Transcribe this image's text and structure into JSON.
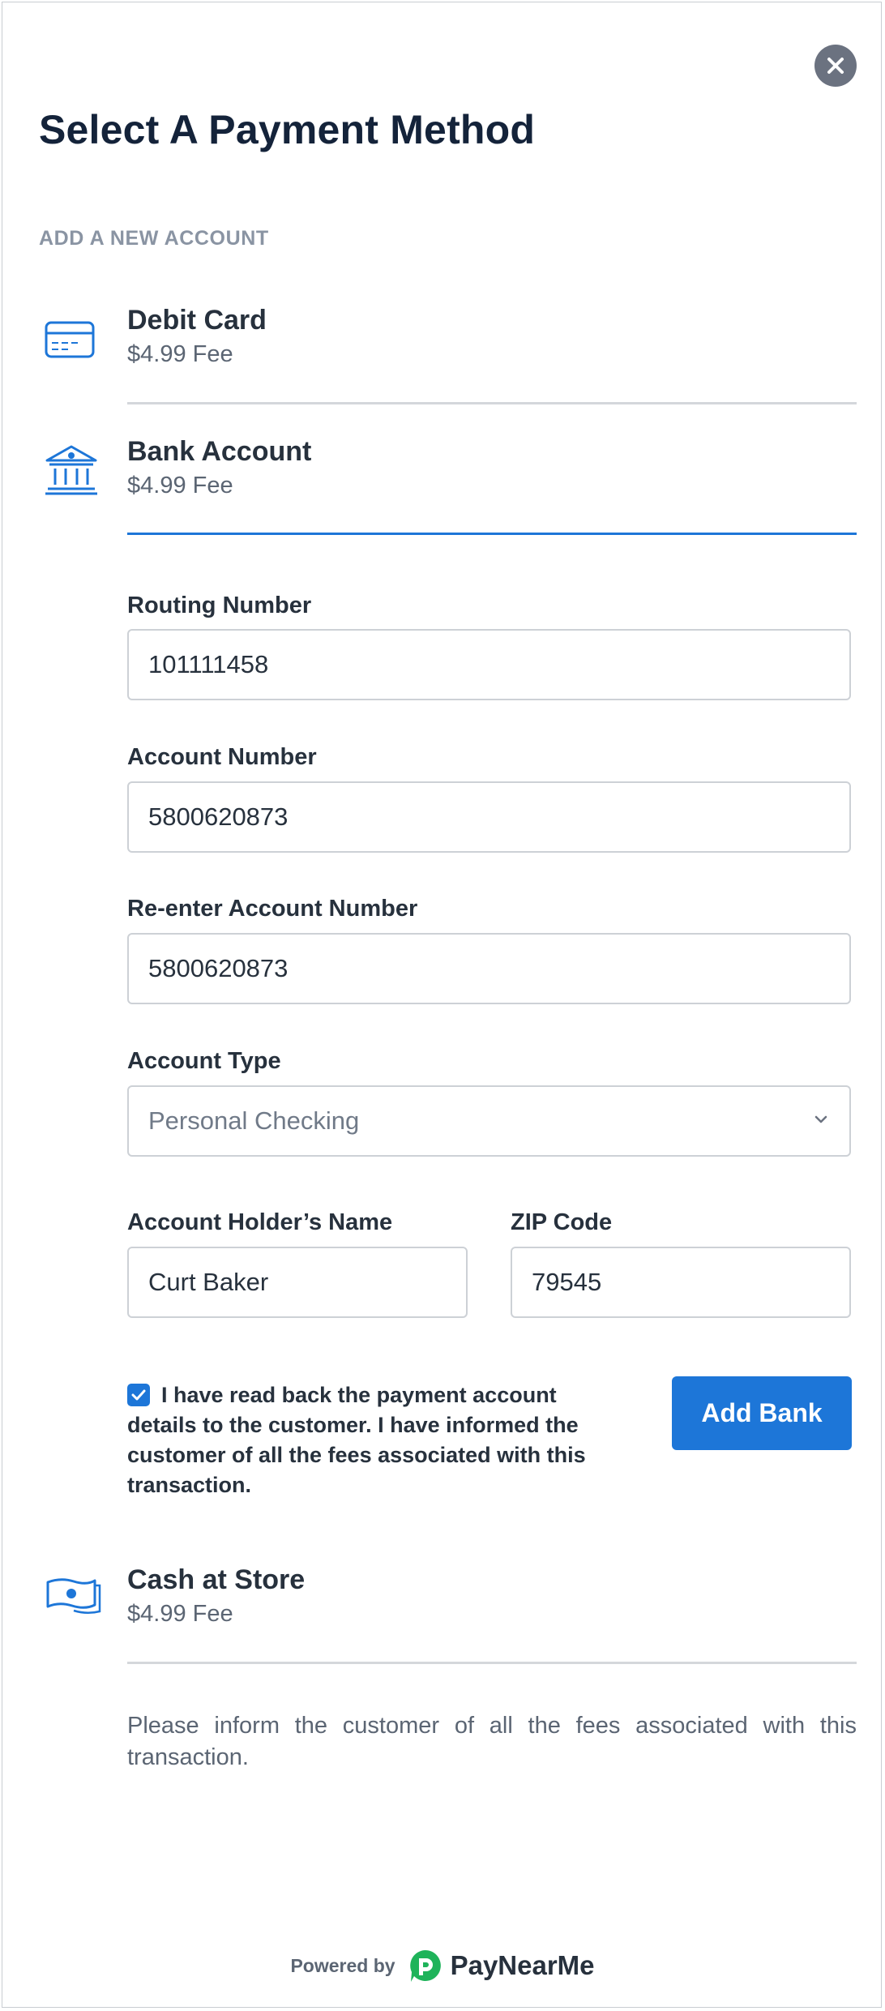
{
  "header": {
    "title": "Select A Payment Method"
  },
  "section_label": "ADD A NEW ACCOUNT",
  "methods": {
    "debit": {
      "name": "Debit Card",
      "fee": "$4.99 Fee"
    },
    "bank": {
      "name": "Bank Account",
      "fee": "$4.99 Fee"
    },
    "cash": {
      "name": "Cash at Store",
      "fee": "$4.99 Fee"
    }
  },
  "form": {
    "routing": {
      "label": "Routing Number",
      "value": "101111458"
    },
    "account": {
      "label": "Account Number",
      "value": "5800620873"
    },
    "reaccount": {
      "label": "Re-enter Account Number",
      "value": "5800620873"
    },
    "type": {
      "label": "Account Type",
      "value": "Personal Checking"
    },
    "holder": {
      "label": "Account Holder’s Name",
      "value": "Curt Baker"
    },
    "zip": {
      "label": "ZIP Code",
      "value": "79545"
    },
    "consent": "I have read back the payment account details to the customer. I have informed the customer of all the fees associated with this transaction.",
    "consent_checked": true,
    "submit_label": "Add Bank"
  },
  "notice": "Please inform the customer of all the fees associated with this transaction.",
  "footer": {
    "powered_by": "Powered by",
    "brand": "PayNearMe"
  },
  "colors": {
    "accent": "#1d76d8",
    "brand_green": "#1fb35a",
    "title": "#14233a"
  }
}
